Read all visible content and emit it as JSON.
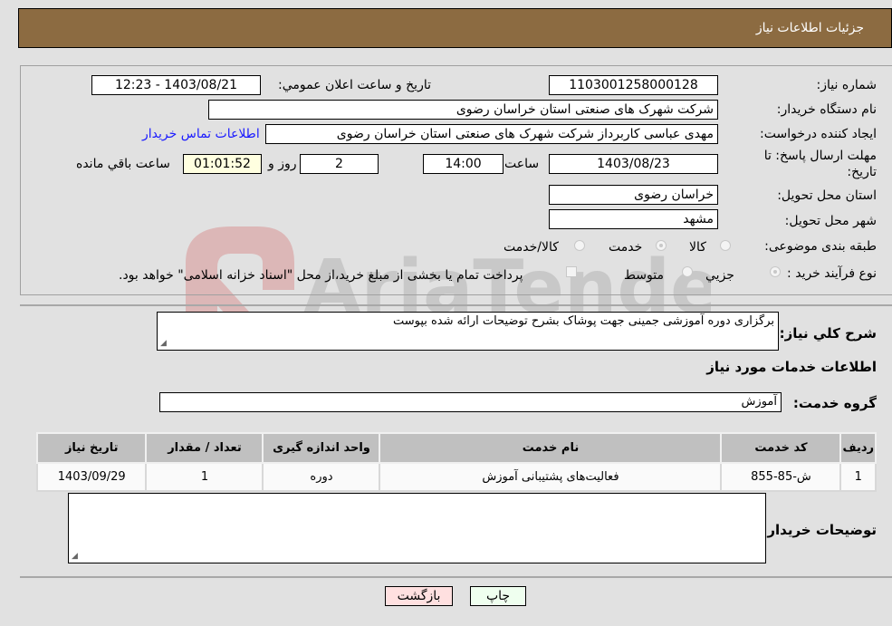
{
  "header": {
    "title": "جزئیات اطلاعات نیاز"
  },
  "form": {
    "need_number": {
      "label": "شماره نیاز:",
      "value": "1103001258000128"
    },
    "announce_datetime": {
      "label": "تاریخ و ساعت اعلان عمومي:",
      "value": "1403/08/21 - 12:23"
    },
    "buyer_org": {
      "label": "نام دستگاه خريدار:",
      "value": "شرکت شهرک های صنعتی استان خراسان رضوی"
    },
    "requester": {
      "label": "ایجاد کننده درخواست:",
      "value": "مهدی عباسی کاربرداز شرکت شهرک های صنعتی استان خراسان رضوی"
    },
    "buyer_contact_link": "اطلاعات تماس خریدار",
    "deadline": {
      "label_line1": "مهلت ارسال پاسخ: تا",
      "label_line2": "تاریخ:",
      "date": "1403/08/23",
      "time_label": "ساعت",
      "time": "14:00",
      "days": "2",
      "days_label": "روز و",
      "remaining": "01:01:52",
      "remaining_label": "ساعت باقي مانده"
    },
    "delivery_province": {
      "label": "استان محل تحویل:",
      "value": "خراسان رضوی"
    },
    "delivery_city": {
      "label": "شهر محل تحویل:",
      "value": "مشهد"
    },
    "category": {
      "label": "طبقه بندی موضوعی:",
      "options": [
        {
          "label": "کالا",
          "checked": false
        },
        {
          "label": "خدمت",
          "checked": true
        },
        {
          "label": "کالا/خدمت",
          "checked": false
        }
      ]
    },
    "purchase_process": {
      "label": "نوع فرآیند خرید :",
      "options": [
        {
          "label": "جزيي",
          "checked": true
        },
        {
          "label": "متوسط",
          "checked": false
        }
      ],
      "payment_note": "پرداخت تمام یا بخشی از مبلغ خرید،از محل \"اسناد خزانه اسلامی\" خواهد بود."
    }
  },
  "description": {
    "label": "شرح کلي نياز:",
    "value": "برگزاری دوره آموزشی جمینی جهت پوشاک  بشرح توضیحات ارائه شده بپوست"
  },
  "services": {
    "section_title": "اطلاعات خدمات مورد نیاز",
    "group_label": "گروه خدمت:",
    "group_value": "آموزش",
    "columns": [
      "ردیف",
      "کد خدمت",
      "نام خدمت",
      "واحد اندازه گیری",
      "تعداد / مقدار",
      "تاریخ نیاز"
    ],
    "rows": [
      [
        "1",
        "ش-85-855",
        "فعالیت‌های پشتیبانی آموزش",
        "دوره",
        "1",
        "1403/09/29"
      ]
    ]
  },
  "buyer_notes": {
    "label": "توضیحات خریدار:",
    "value": ""
  },
  "buttons": {
    "print": "چاپ",
    "back": "بازگشت"
  },
  "watermark": {
    "text": "AriaTender.net"
  },
  "colors": {
    "header_bg": "#8c6b41",
    "print_bg": "#efffef",
    "back_bg": "#ffe0e0",
    "remaining_bg": "#ffffe0",
    "link": "#1a1aff"
  }
}
